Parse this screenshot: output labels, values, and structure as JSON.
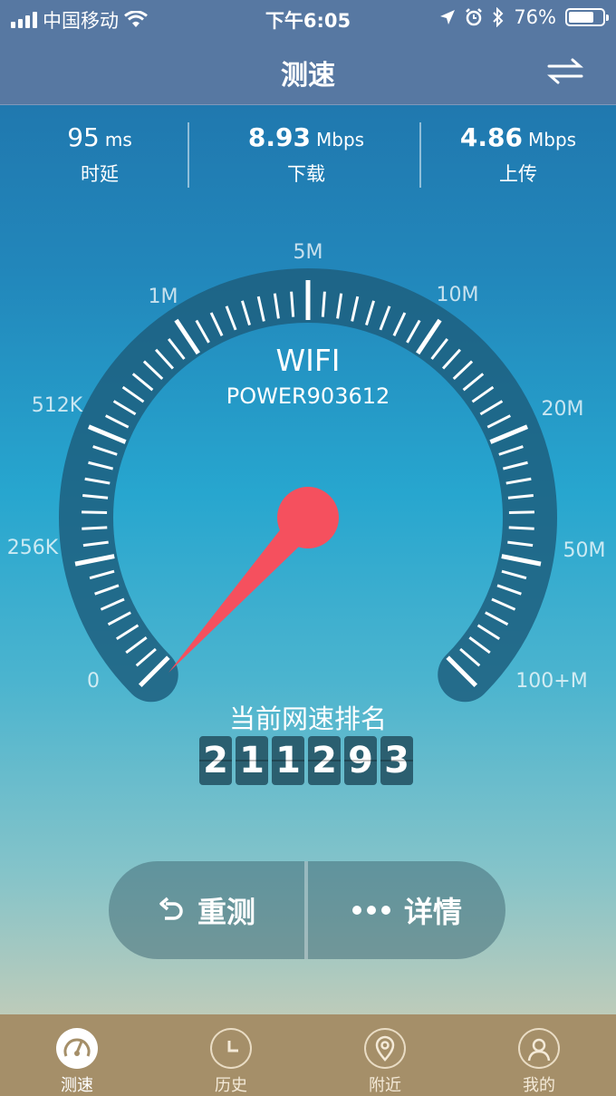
{
  "status": {
    "carrier": "中国移动",
    "time": "下午6:05",
    "battery": "76%",
    "battery_level": 0.76
  },
  "nav": {
    "title": "测速"
  },
  "stats": [
    {
      "value": "95",
      "unit": "ms",
      "label": "时延"
    },
    {
      "value": "8.93",
      "unit": "Mbps",
      "label": "下载"
    },
    {
      "value": "4.86",
      "unit": "Mbps",
      "label": "上传"
    }
  ],
  "gauge": {
    "network_type": "WIFI",
    "network_name": "POWER903612",
    "scale_labels": [
      "0",
      "256K",
      "512K",
      "1M",
      "5M",
      "10M",
      "20M",
      "50M",
      "100+M"
    ],
    "needle_label": "0"
  },
  "rank": {
    "title": "当前网速排名",
    "digits": [
      "2",
      "1",
      "1",
      "2",
      "9",
      "3"
    ]
  },
  "actions": {
    "retest": "重测",
    "details": "详情"
  },
  "tabs": [
    {
      "label": "测速",
      "active": true
    },
    {
      "label": "历史",
      "active": false
    },
    {
      "label": "附近",
      "active": false
    },
    {
      "label": "我的",
      "active": false
    }
  ],
  "colors": {
    "needle": "#f5505e",
    "gauge_ring": "#1d5f7f",
    "tabbar": "#a58f69",
    "navbar": "#5778a2"
  }
}
